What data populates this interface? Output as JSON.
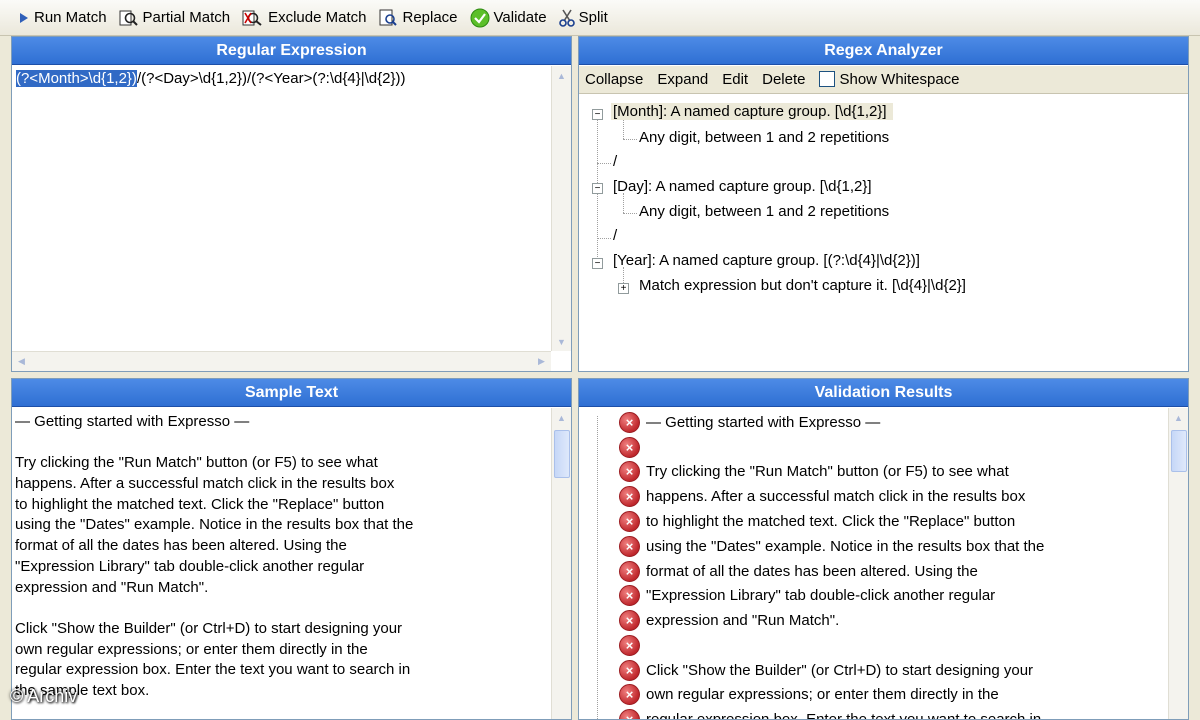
{
  "toolbar": {
    "run_match": "Run Match",
    "partial_match": "Partial Match",
    "exclude_match": "Exclude Match",
    "replace": "Replace",
    "validate": "Validate",
    "split": "Split"
  },
  "regex_pane": {
    "title": "Regular Expression",
    "selected": "(?<Month>\\d{1,2})",
    "rest": "/(?<Day>\\d{1,2})/(?<Year>(?:\\d{4}|\\d{2}))"
  },
  "analyzer": {
    "title": "Regex Analyzer",
    "collapse": "Collapse",
    "expand": "Expand",
    "edit": "Edit",
    "delete": "Delete",
    "show_whitespace": "Show Whitespace",
    "nodes": [
      "[Month]: A named capture group. [\\d{1,2}]",
      "Any digit, between 1 and 2 repetitions",
      "/",
      "[Day]: A named capture group. [\\d{1,2}]",
      "Any digit, between 1 and 2 repetitions",
      "/",
      "[Year]: A named capture group. [(?:\\d{4}|\\d{2})]",
      "Match expression but don't capture it. [\\d{4}|\\d{2}]"
    ]
  },
  "sample": {
    "title": "Sample Text",
    "lines": [
      "— Getting started with Expresso —",
      "",
      "Try clicking the \"Run Match\" button (or F5) to see what",
      "happens. After a successful match click in the results box",
      "to highlight the matched text. Click the \"Replace\" button",
      "using the \"Dates\" example. Notice in the results box that the",
      "format of all the dates has been altered. Using the",
      "\"Expression Library\" tab double-click another regular",
      "expression and \"Run Match\".",
      "",
      "Click \"Show the Builder\" (or Ctrl+D) to start designing your",
      "own regular expressions; or enter them directly in the",
      "regular expression box. Enter the text you want to search in",
      "the sample text box."
    ]
  },
  "validation": {
    "title": "Validation Results",
    "rows": [
      "— Getting started with Expresso —",
      "",
      "Try clicking the \"Run Match\" button (or F5) to see what",
      "happens. After a successful match click in the results box",
      "to highlight the matched text. Click the \"Replace\" button",
      "using the \"Dates\" example. Notice in the results box that the",
      "format of all the dates has been altered. Using the",
      "\"Expression Library\" tab double-click another regular",
      "expression and \"Run Match\".",
      "",
      "Click \"Show the Builder\" (or Ctrl+D) to start designing your",
      "own regular expressions; or enter them directly in the",
      "regular expression box. Enter the text you want to search in"
    ]
  },
  "watermark": "© Archiv"
}
